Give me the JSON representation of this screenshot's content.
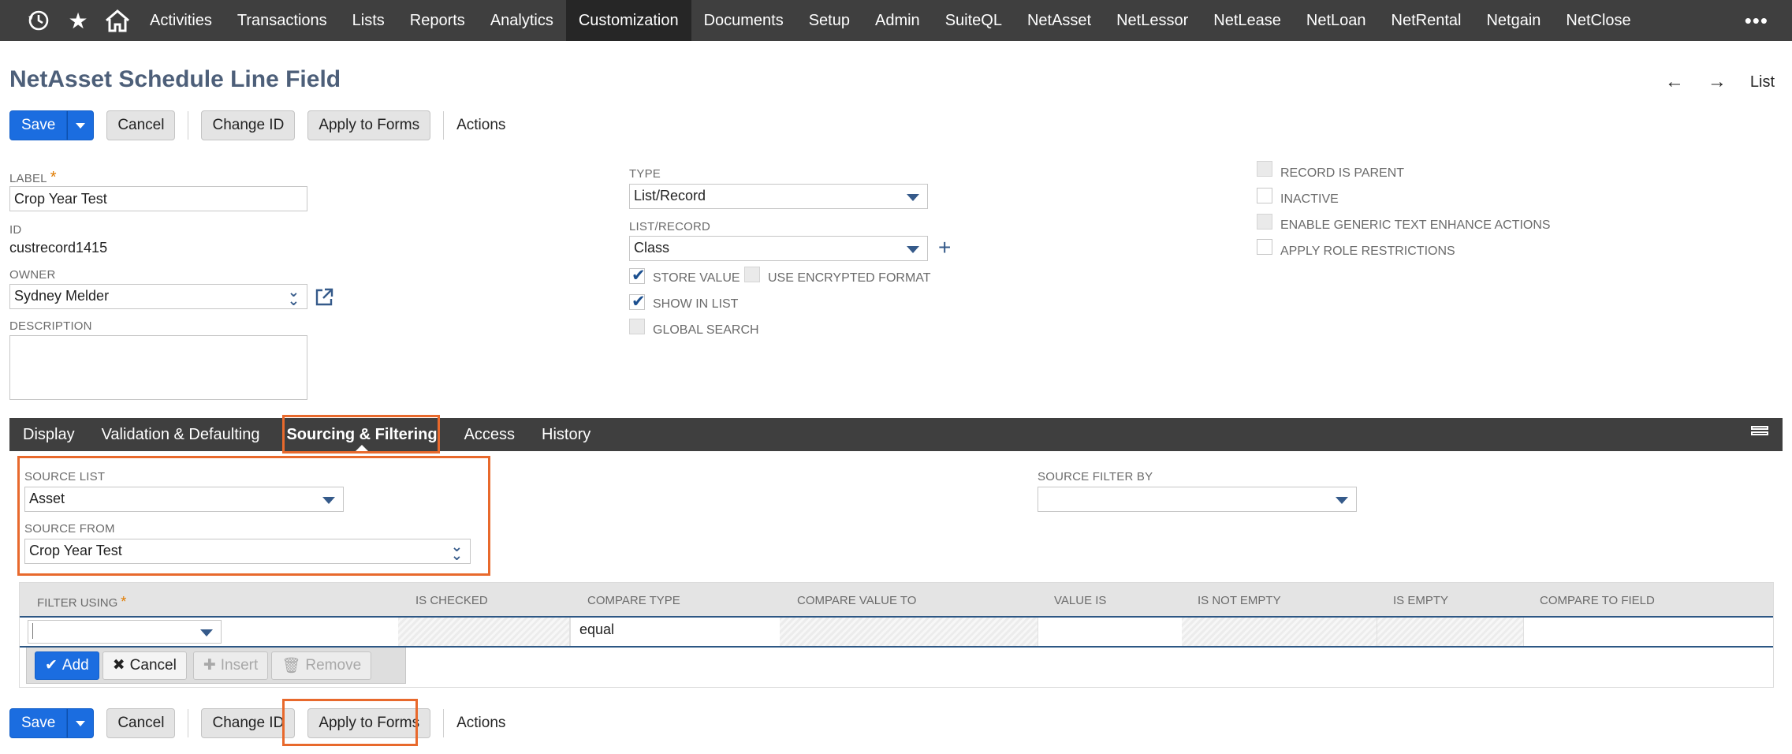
{
  "nav": {
    "items": [
      "Activities",
      "Transactions",
      "Lists",
      "Reports",
      "Analytics",
      "Customization",
      "Documents",
      "Setup",
      "Admin",
      "SuiteQL",
      "NetAsset",
      "NetLessor",
      "NetLease",
      "NetLoan",
      "NetRental",
      "Netgain",
      "NetClose"
    ],
    "active": "Customization",
    "icons": [
      "recent-history-icon",
      "star-icon",
      "home-icon"
    ],
    "more": "•••"
  },
  "page": {
    "title": "NetAsset Schedule Line Field",
    "pager_prev": "←",
    "pager_next": "→",
    "pager_list": "List"
  },
  "buttons": {
    "save": "Save",
    "cancel": "Cancel",
    "change_id": "Change ID",
    "apply_to_forms": "Apply to Forms",
    "actions": "Actions"
  },
  "fields": {
    "label": {
      "label": "LABEL",
      "value": "Crop Year Test"
    },
    "id": {
      "label": "ID",
      "value": "custrecord1415"
    },
    "owner": {
      "label": "OWNER",
      "value": "Sydney Melder"
    },
    "description": {
      "label": "DESCRIPTION",
      "value": ""
    },
    "type": {
      "label": "TYPE",
      "value": "List/Record"
    },
    "list_record": {
      "label": "LIST/RECORD",
      "value": "Class"
    },
    "store_value": {
      "label": "STORE VALUE",
      "checked": true
    },
    "use_encrypted_format": {
      "label": "USE ENCRYPTED FORMAT",
      "checked": false
    },
    "show_in_list": {
      "label": "SHOW IN LIST",
      "checked": true
    },
    "global_search": {
      "label": "GLOBAL SEARCH",
      "checked": false
    },
    "record_is_parent": {
      "label": "RECORD IS PARENT",
      "checked": false
    },
    "inactive": {
      "label": "INACTIVE",
      "checked": false
    },
    "enable_generic_text": {
      "label": "ENABLE GENERIC TEXT ENHANCE ACTIONS",
      "checked": false
    },
    "apply_role_restrictions": {
      "label": "APPLY ROLE RESTRICTIONS",
      "checked": false
    }
  },
  "tabs": [
    "Display",
    "Validation & Defaulting",
    "Sourcing & Filtering",
    "Access",
    "History"
  ],
  "active_tab": "Sourcing & Filtering",
  "sourcing": {
    "source_list": {
      "label": "SOURCE LIST",
      "value": "Asset"
    },
    "source_from": {
      "label": "SOURCE FROM",
      "value": "Crop Year Test"
    },
    "source_filter_by": {
      "label": "SOURCE FILTER BY",
      "value": ""
    }
  },
  "sublist": {
    "columns": [
      "FILTER USING",
      "IS CHECKED",
      "COMPARE TYPE",
      "COMPARE VALUE TO",
      "VALUE IS",
      "IS NOT EMPTY",
      "IS EMPTY",
      "COMPARE TO FIELD"
    ],
    "row": {
      "filter_using": "",
      "compare_type": "equal"
    },
    "buttons": {
      "add": "Add",
      "cancel": "Cancel",
      "insert": "Insert",
      "remove": "Remove"
    }
  },
  "colors": {
    "accent": "#1b6de0",
    "nav_bg": "#3f3f3f",
    "highlight": "#e8692c",
    "title": "#4d5f79"
  }
}
